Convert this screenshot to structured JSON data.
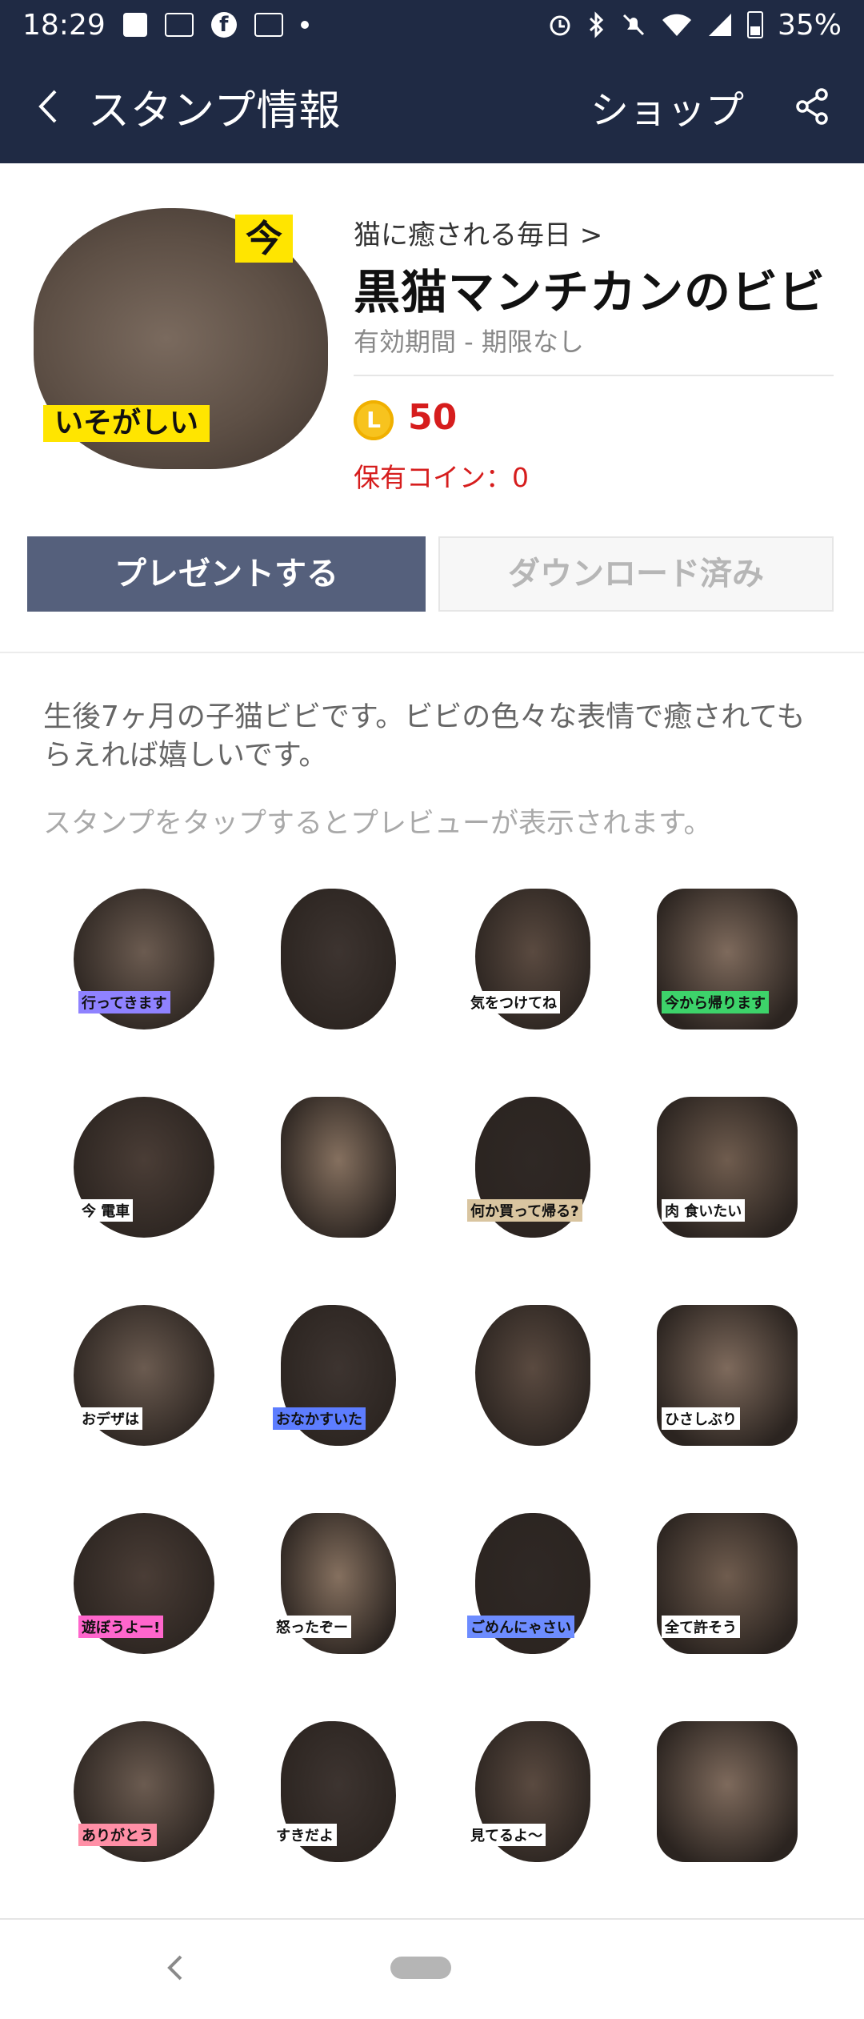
{
  "status_bar": {
    "time": "18:29",
    "battery": "35%",
    "icons_left": [
      "message-icon",
      "pass-icon",
      "facebook-icon",
      "pass-icon",
      "dot-icon"
    ],
    "icons_right": [
      "alarm-icon",
      "bluetooth-icon",
      "mute-icon",
      "wifi-icon",
      "signal-icon",
      "battery-icon"
    ]
  },
  "header": {
    "title": "スタンプ情報",
    "shop_label": "ショップ",
    "back_icon": "chevron-left-icon",
    "share_icon": "share-icon"
  },
  "product": {
    "author": "猫に癒される毎日 >",
    "name": "黒猫マンチカンのビビ",
    "validity": "有効期間 - 期限なし",
    "coin_symbol": "L",
    "price": "50",
    "owned_coins": "保有コイン：0",
    "main_sticker_texts": [
      "今",
      "いそがしい"
    ]
  },
  "buttons": {
    "gift": "プレゼントする",
    "downloaded": "ダウンロード済み"
  },
  "description": "生後7ヶ月の子猫ビビです。ビビの色々な表情で癒されてもらえれば嬉しいです。",
  "preview_hint": "スタンプをタップするとプレビューが表示されます。",
  "stickers": [
    {
      "text": "行ってきます"
    },
    {
      "text": ""
    },
    {
      "text": "気をつけてね"
    },
    {
      "text": "今から帰ります"
    },
    {
      "text": "今 電車"
    },
    {
      "text": ""
    },
    {
      "text": "何か買って帰る?"
    },
    {
      "text": "肉 食いたい"
    },
    {
      "text": "おデザは"
    },
    {
      "text": "おなかすいた"
    },
    {
      "text": ""
    },
    {
      "text": "ひさしぶり"
    },
    {
      "text": "遊ぼうよー!"
    },
    {
      "text": "怒ったぞー"
    },
    {
      "text": "ごめんにゃさい"
    },
    {
      "text": "全て許そう"
    },
    {
      "text": "ありがとう"
    },
    {
      "text": "すきだよ"
    },
    {
      "text": "見てるよ〜"
    },
    {
      "text": ""
    }
  ],
  "colors": {
    "header_bg": "#1f2a44",
    "price_red": "#d61d1d",
    "gift_button": "#55607c",
    "coin_gold": "#f7c31e"
  }
}
